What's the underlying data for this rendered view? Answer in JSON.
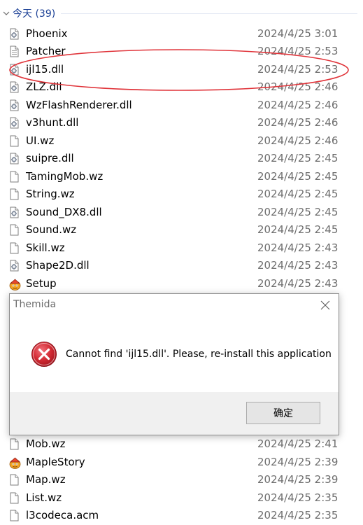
{
  "group": {
    "title": "今天 (39)"
  },
  "files": [
    {
      "name": "Phoenix",
      "date": "2024/4/25 3:01",
      "icon": "dll-file-icon"
    },
    {
      "name": "Patcher",
      "date": "2024/4/25 2:53",
      "icon": "generic-file-icon"
    },
    {
      "name": "ijl15.dll",
      "date": "2024/4/25 2:53",
      "icon": "dll-file-icon"
    },
    {
      "name": "ZLZ.dll",
      "date": "2024/4/25 2:46",
      "icon": "dll-file-icon"
    },
    {
      "name": "WzFlashRenderer.dll",
      "date": "2024/4/25 2:46",
      "icon": "dll-file-icon"
    },
    {
      "name": "v3hunt.dll",
      "date": "2024/4/25 2:46",
      "icon": "dll-file-icon"
    },
    {
      "name": "UI.wz",
      "date": "2024/4/25 2:46",
      "icon": "blank-file-icon"
    },
    {
      "name": "suipre.dll",
      "date": "2024/4/25 2:45",
      "icon": "dll-file-icon"
    },
    {
      "name": "TamingMob.wz",
      "date": "2024/4/25 2:45",
      "icon": "blank-file-icon"
    },
    {
      "name": "String.wz",
      "date": "2024/4/25 2:45",
      "icon": "blank-file-icon"
    },
    {
      "name": "Sound_DX8.dll",
      "date": "2024/4/25 2:45",
      "icon": "dll-file-icon"
    },
    {
      "name": "Sound.wz",
      "date": "2024/4/25 2:45",
      "icon": "blank-file-icon"
    },
    {
      "name": "Skill.wz",
      "date": "2024/4/25 2:43",
      "icon": "blank-file-icon"
    },
    {
      "name": "Shape2D.dll",
      "date": "2024/4/25 2:43",
      "icon": "dll-file-icon"
    },
    {
      "name": "Setup",
      "date": "2024/4/25 2:43",
      "icon": "maplestory-app-icon"
    },
    {
      "name": "Mob.wz",
      "date": "2024/4/25 2:41",
      "icon": "blank-file-icon"
    },
    {
      "name": "MapleStory",
      "date": "2024/4/25 2:39",
      "icon": "maplestory-app-icon"
    },
    {
      "name": "Map.wz",
      "date": "2024/4/25 2:39",
      "icon": "blank-file-icon"
    },
    {
      "name": "List.wz",
      "date": "2024/4/25 2:35",
      "icon": "blank-file-icon"
    },
    {
      "name": "l3codeca.acm",
      "date": "2024/4/25 2:35",
      "icon": "blank-file-icon"
    }
  ],
  "dialog": {
    "title": "Themida",
    "message": "Cannot find 'ijl15.dll'. Please, re-install this application",
    "ok_label": "确定",
    "icon": "error-icon",
    "close_icon": "close-icon"
  },
  "colors": {
    "highlight_ellipse": "#e0343a",
    "group_title": "#1a3f95",
    "error_red": "#c8202a"
  }
}
